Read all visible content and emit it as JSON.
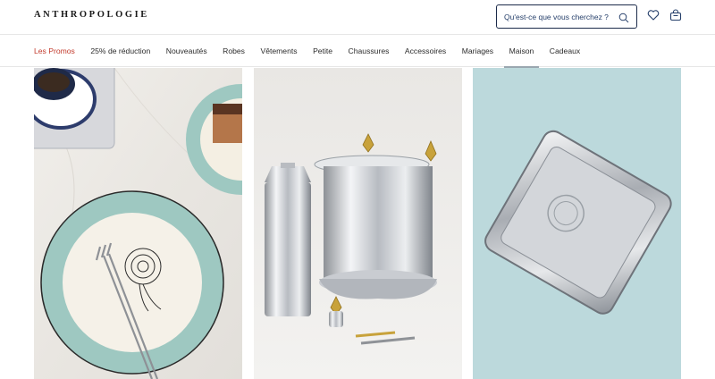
{
  "header": {
    "logo": "ANTHROPOLOGIE",
    "search": {
      "placeholder": "Qu'est-ce que vous cherchez ?"
    },
    "icons": [
      "search-icon",
      "heart-icon",
      "bag-icon"
    ]
  },
  "nav": {
    "items": [
      {
        "label": "Les Promos",
        "state": "promo"
      },
      {
        "label": "25% de réduction"
      },
      {
        "label": "Nouveautés"
      },
      {
        "label": "Robes"
      },
      {
        "label": "Vêtements"
      },
      {
        "label": "Petite"
      },
      {
        "label": "Chaussures"
      },
      {
        "label": "Accessoires"
      },
      {
        "label": "Mariages"
      },
      {
        "label": "Maison",
        "state": "active"
      },
      {
        "label": "Cadeaux"
      }
    ]
  },
  "colors": {
    "promo": "#c23a2c",
    "search_border": "#1c2b4a",
    "active_underline": "#9aa7b0",
    "card3_bg": "#bcd9dc"
  },
  "products": [
    {
      "image": "plates-and-forks-on-marble"
    },
    {
      "image": "silver-ice-bucket-and-cocktail-shaker"
    },
    {
      "image": "silver-serving-tray-on-blue"
    }
  ]
}
